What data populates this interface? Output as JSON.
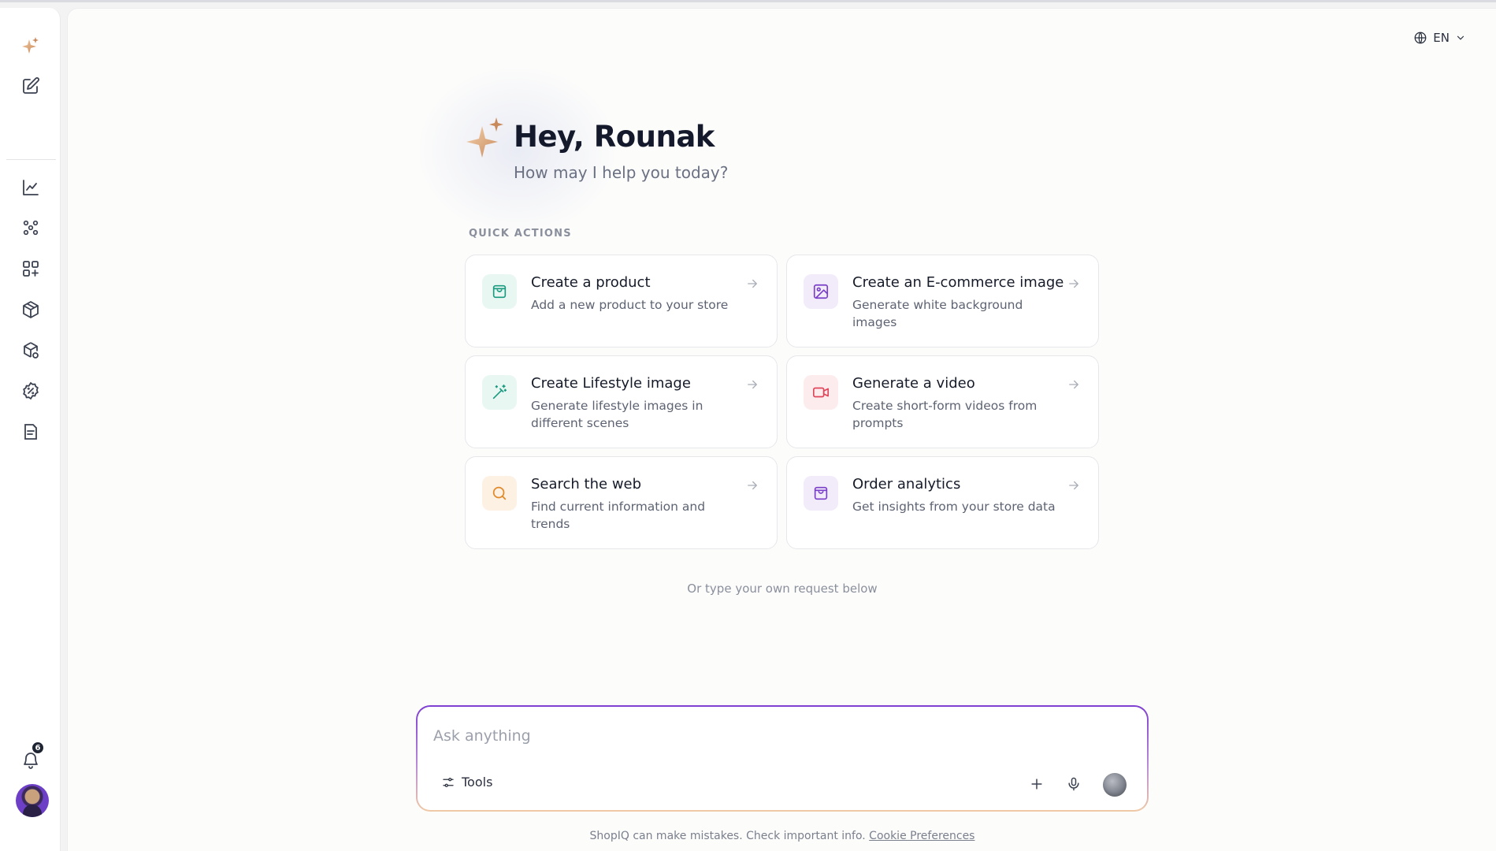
{
  "header": {
    "language": "EN"
  },
  "hero": {
    "greeting": "Hey, Rounak",
    "subtitle": "How may I help you today?"
  },
  "quick_actions": {
    "heading": "QUICK ACTIONS",
    "items": [
      {
        "title": "Create a product",
        "desc": "Add a new product to your store",
        "icon": "shopping-bag-icon",
        "color": "#1a9a7f",
        "bg": "#e9f7f3"
      },
      {
        "title": "Create an E-commerce image",
        "desc": "Generate white background images",
        "icon": "image-icon",
        "color": "#7a3fc8",
        "bg": "#f1ebfa"
      },
      {
        "title": "Create Lifestyle image",
        "desc": "Generate lifestyle images in different scenes",
        "icon": "magic-wand-icon",
        "color": "#1a9a7f",
        "bg": "#e9f7f3"
      },
      {
        "title": "Generate a video",
        "desc": "Create short-form videos from prompts",
        "icon": "video-icon",
        "color": "#e0455a",
        "bg": "#fdecee"
      },
      {
        "title": "Search the web",
        "desc": "Find current information and trends",
        "icon": "search-icon",
        "color": "#e08a2a",
        "bg": "#fdf1e4"
      },
      {
        "title": "Order analytics",
        "desc": "Get insights from your store data",
        "icon": "shopping-bag-icon",
        "color": "#7a3fc8",
        "bg": "#f1ebfa"
      }
    ]
  },
  "hint": "Or type your own request below",
  "composer": {
    "placeholder": "Ask anything",
    "tools_label": "Tools"
  },
  "footer": {
    "note": "ShopIQ can make mistakes. Check important info.",
    "link": "Cookie Preferences"
  },
  "sidebar": {
    "notification_count": "6"
  },
  "colors": {
    "accent": "#7e3fd1",
    "star_gold": "#d9a679"
  }
}
